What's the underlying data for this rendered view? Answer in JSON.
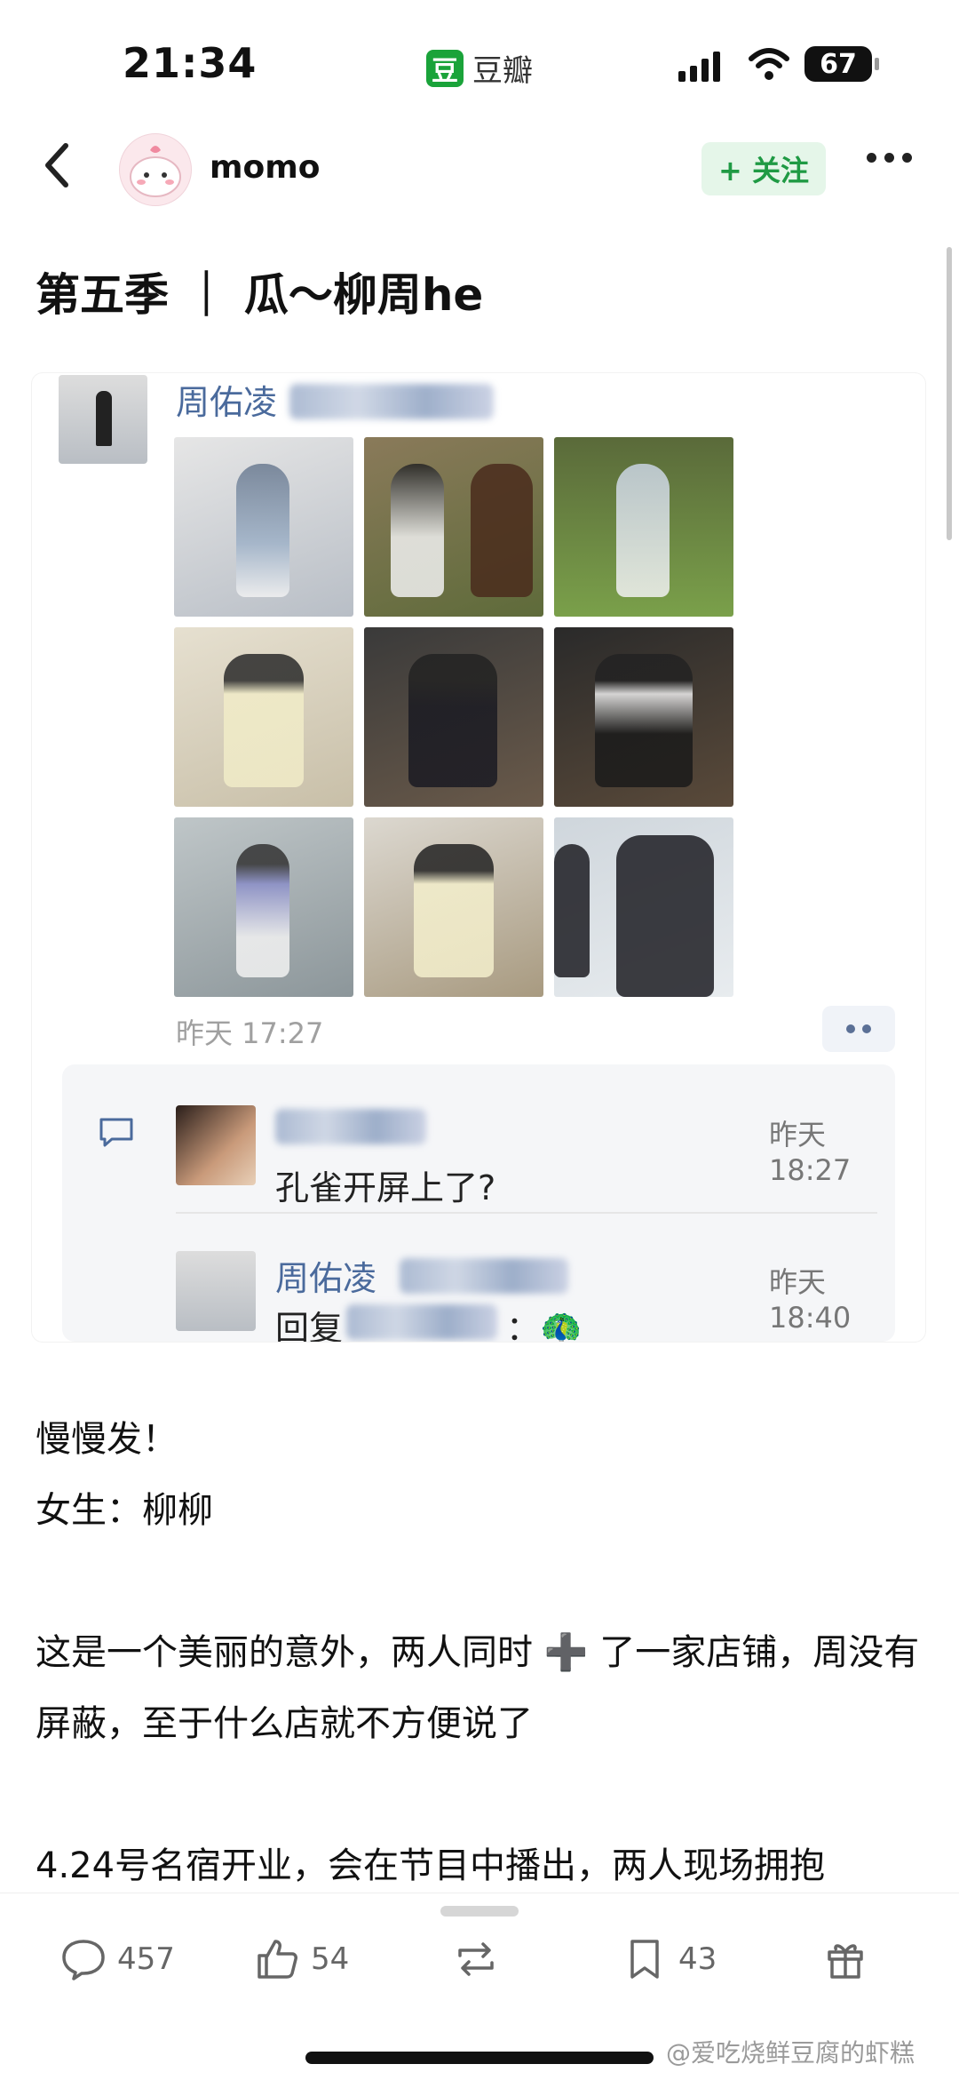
{
  "status_bar": {
    "time": "21:34",
    "app_name": "豆瓣",
    "app_logo_char": "豆",
    "battery": "67"
  },
  "nav": {
    "author": "momo",
    "follow_label": "+ 关注"
  },
  "post": {
    "title": "第五季 ｜ 瓜～柳周he",
    "card": {
      "poster_name": "周佑凌",
      "time": "昨天 17:27",
      "comments": [
        {
          "time": "昨天 18:27",
          "text": "孔雀开屏上了?"
        },
        {
          "name": "周佑凌",
          "time": "昨天 18:40",
          "text_prefix": "回复",
          "text_suffix": "：🦚"
        }
      ]
    },
    "paragraphs": [
      "慢慢发！",
      "女生：柳柳",
      "",
      "这是一个美丽的意外，两人同时 ➕ 了一家店铺，周没有屏蔽，至于什么店就不方便说了",
      "",
      "4.24号名宿开业，会在节目中播出，两人现场拥抱"
    ]
  },
  "bottom_bar": {
    "comments": "457",
    "likes": "54",
    "bookmarks": "43"
  },
  "watermark": "@爱吃烧鲜豆腐的虾糕",
  "colors": {
    "accent_green": "#1f9a44",
    "link_blue": "#4a6a9c"
  }
}
